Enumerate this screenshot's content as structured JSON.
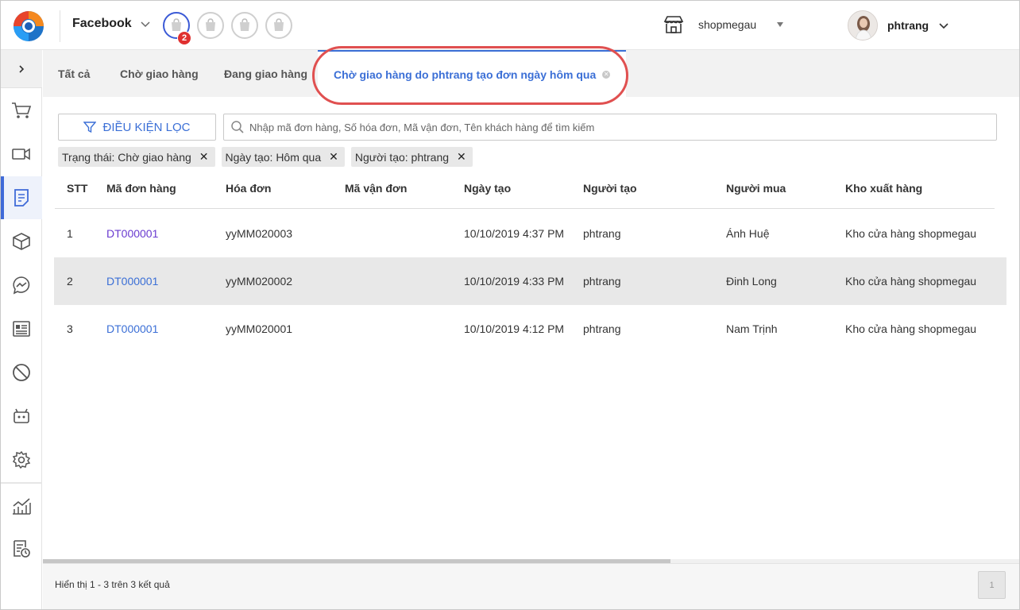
{
  "header": {
    "channel_label": "Facebook",
    "notification_count": "2",
    "store_name": "shopmegau",
    "user_name": "phtrang"
  },
  "tabs": [
    {
      "label": "Tất cả"
    },
    {
      "label": "Chờ giao hàng"
    },
    {
      "label": "Đang giao hàng"
    },
    {
      "label": "Chờ giao hàng do phtrang tạo đơn ngày hôm qua"
    }
  ],
  "filter": {
    "button_label": "ĐIỀU KIỆN LỌC",
    "search_placeholder": "Nhập mã đơn hàng, Số hóa đơn, Mã vận đơn, Tên khách hàng để tìm kiếm",
    "chips": [
      {
        "label": "Trạng thái: Chờ giao hàng"
      },
      {
        "label": "Ngày tạo: Hôm qua"
      },
      {
        "label": "Người tạo: phtrang"
      }
    ]
  },
  "table": {
    "columns": [
      "STT",
      "Mã đơn hàng",
      "Hóa đơn",
      "Mã vận đơn",
      "Ngày tạo",
      "Người tạo",
      "Người mua",
      "Kho xuất hàng"
    ],
    "rows": [
      {
        "stt": "1",
        "order": "DT000001",
        "invoice": "yyMM020003",
        "tracking": "",
        "created": "10/10/2019 4:37 PM",
        "creator": "phtrang",
        "buyer": "Ánh Huệ",
        "warehouse": "Kho cửa hàng shopmegau"
      },
      {
        "stt": "2",
        "order": "DT000001",
        "invoice": "yyMM020002",
        "tracking": "",
        "created": "10/10/2019 4:33 PM",
        "creator": "phtrang",
        "buyer": "Đinh Long",
        "warehouse": "Kho cửa hàng shopmegau"
      },
      {
        "stt": "3",
        "order": "DT000001",
        "invoice": "yyMM020001",
        "tracking": "",
        "created": "10/10/2019 4:12 PM",
        "creator": "phtrang",
        "buyer": "Nam Trịnh",
        "warehouse": "Kho cửa hàng shopmegau"
      }
    ]
  },
  "footer": {
    "summary": "Hiển thị 1 - 3 trên 3 kết quả",
    "page": "1"
  },
  "colors": {
    "accent": "#3b6fd6",
    "highlight_ring": "#e05050",
    "badge": "#e03030"
  }
}
